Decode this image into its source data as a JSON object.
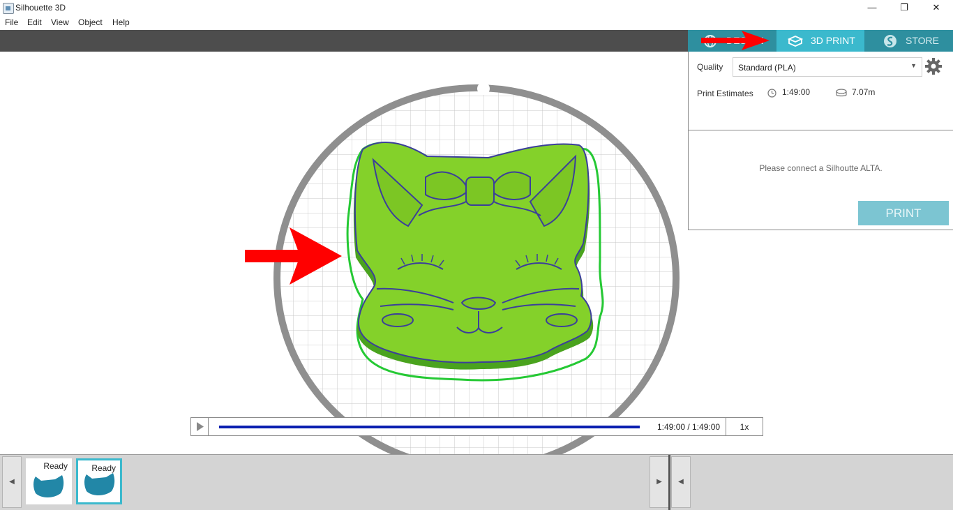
{
  "window": {
    "title": "Silhouette 3D",
    "minimize": "—",
    "restore": "❐",
    "close": "✕"
  },
  "menu": {
    "items": [
      "File",
      "Edit",
      "View",
      "Object",
      "Help"
    ]
  },
  "modes": {
    "tabs": [
      {
        "label": "DESIGN",
        "icon": "globe-icon",
        "active": false
      },
      {
        "label": "3D PRINT",
        "icon": "cube-icon",
        "active": true
      },
      {
        "label": "STORE",
        "icon": "store-icon",
        "active": false
      }
    ]
  },
  "panel": {
    "quality_label": "Quality",
    "quality_value": "Standard (PLA)",
    "estimates_label": "Print Estimates",
    "time_estimate": "1:49:00",
    "filament_estimate": "7.07m",
    "connect_message": "Please connect a Silhoutte ALTA.",
    "print_button": "PRINT"
  },
  "playback": {
    "progress": 1.0,
    "time_text": "1:49:00 / 1:49:00",
    "speed": "1x"
  },
  "tray": {
    "items": [
      {
        "status": "Ready",
        "selected": false
      },
      {
        "status": "Ready",
        "selected": true
      }
    ]
  },
  "colors": {
    "accent": "#3bb9cd",
    "toolbar": "#4d4d4d",
    "model_green": "#7ed321",
    "model_outline": "#3b3f9a",
    "annotation_arrow": "#ff0000"
  }
}
